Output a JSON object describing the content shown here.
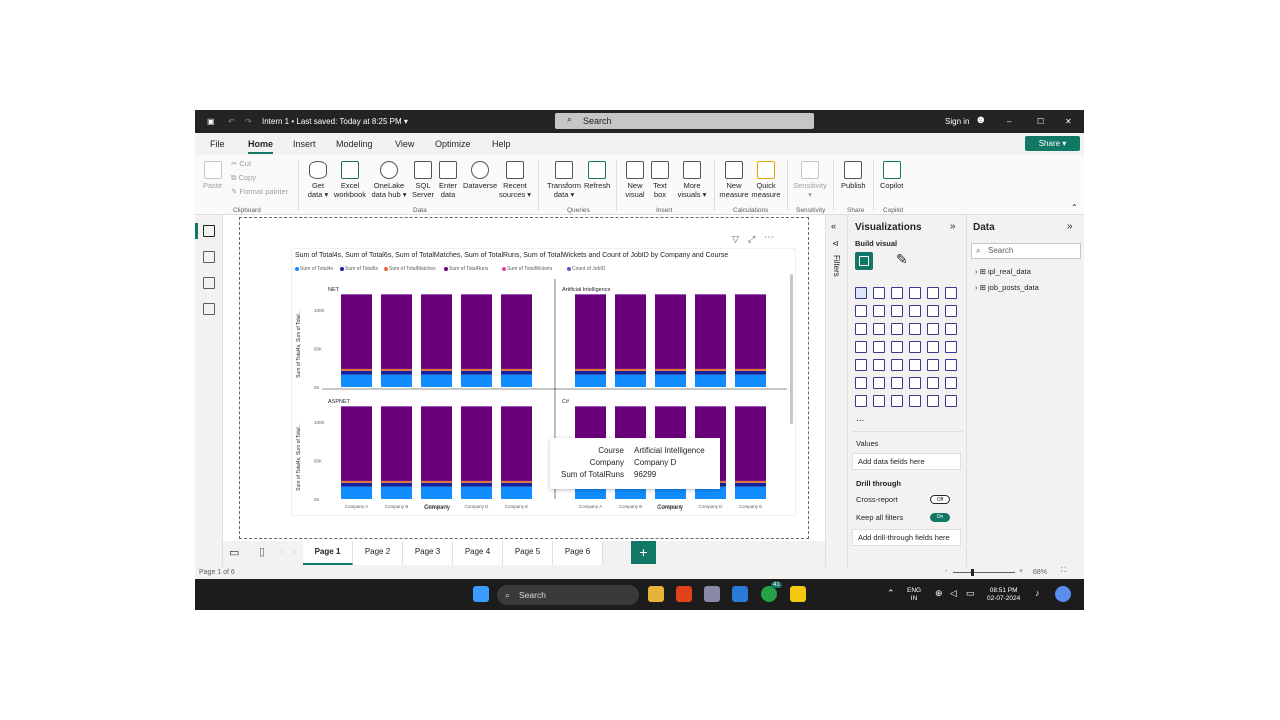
{
  "titlebar": {
    "doc_title": "Intern 1 • Last saved: Today at 8:25 PM ▾",
    "search": "Search",
    "signin": "Sign in",
    "minimize": "–",
    "maximize": "☐",
    "close": "✕"
  },
  "menu": {
    "file": "File",
    "home": "Home",
    "insert": "Insert",
    "modeling": "Modeling",
    "view": "View",
    "optimize": "Optimize",
    "help": "Help",
    "share": "Share ▾"
  },
  "ribbon": {
    "paste": "Paste",
    "cut": "Cut",
    "copy": "Copy",
    "format_painter": "Format painter",
    "get_data": "Get data ▾",
    "excel": "Excel workbook",
    "onelake": "OneLake data hub ▾",
    "sql": "SQL Server",
    "enter_data": "Enter data",
    "dataverse": "Dataverse",
    "recent": "Recent sources ▾",
    "transform": "Transform data ▾",
    "refresh": "Refresh",
    "new_visual": "New visual",
    "text_box": "Text box",
    "more_visuals": "More visuals ▾",
    "new_measure": "New measure",
    "quick_measure": "Quick measure",
    "sensitivity": "Sensitivity ▾",
    "publish": "Publish",
    "copilot": "Copilot",
    "groups": {
      "clipboard": "Clipboard",
      "data": "Data",
      "queries": "Queries",
      "insert": "Insert",
      "calculations": "Calculations",
      "sensitivity": "Sensitivity",
      "share": "Share",
      "copilot": "Copilot"
    }
  },
  "visual": {
    "title": "Sum of Total4s, Sum of Total6s, Sum of TotalMatches, Sum of TotalRuns, Sum of TotalWickets and Count of JobID by Company and Course",
    "legend": [
      "Sum of Total4s",
      "Sum of Total6s",
      "Sum of TotalMatches",
      "Sum of TotalRuns",
      "Sum of TotalWickets",
      "Count of JobID"
    ],
    "ylabel": "Sum of Total4s, Sum of Total...",
    "xlabel": "Company",
    "yticks": [
      "100K",
      "50K",
      "0K"
    ]
  },
  "chart_data": {
    "type": "bar",
    "stacked": true,
    "small_multiples": [
      "NET",
      "Artificial Intelligence",
      "ASPNET",
      "C#"
    ],
    "categories": [
      "Company A",
      "Company B",
      "Company C",
      "Company D",
      "Company E"
    ],
    "series": [
      {
        "name": "Sum of Total4s",
        "color": "#118dff",
        "values": [
          16000,
          16000,
          16000,
          16000,
          16000
        ]
      },
      {
        "name": "Sum of Total6s",
        "color": "#12239e",
        "values": [
          5000,
          5000,
          5000,
          5000,
          5000
        ]
      },
      {
        "name": "Sum of TotalMatches",
        "color": "#e66c37",
        "values": [
          2500,
          2500,
          2500,
          2500,
          2500
        ]
      },
      {
        "name": "Sum of TotalRuns",
        "color": "#6b007b",
        "values": [
          96299,
          96299,
          96299,
          96299,
          96299
        ]
      },
      {
        "name": "Sum of TotalWickets",
        "color": "#e044a7",
        "values": [
          1000,
          1000,
          1000,
          1000,
          1000
        ]
      },
      {
        "name": "Count of JobID",
        "color": "#744ec2",
        "values": [
          1,
          1,
          1,
          1,
          1
        ]
      }
    ],
    "ylim": [
      0,
      130000
    ],
    "ylabel": "Sum of Total4s, Sum of Total...",
    "xlabel": "Company"
  },
  "tooltip": {
    "k1": "Course",
    "v1": "Artificial Intelligence",
    "k2": "Company",
    "v2": "Company D",
    "k3": "Sum of TotalRuns",
    "v3": "96299"
  },
  "pages": [
    "Page 1",
    "Page 2",
    "Page 3",
    "Page 4",
    "Page 5",
    "Page 6"
  ],
  "add_page": "+",
  "filters": {
    "label": "Filters"
  },
  "viz": {
    "title": "Visualizations",
    "build": "Build visual",
    "values": "Values",
    "add_data": "Add data fields here",
    "drill": "Drill through",
    "cross": "Cross-report",
    "cross_state": "Off",
    "keep": "Keep all filters",
    "keep_state": "On",
    "add_drill": "Add drill-through fields here",
    "more": "..."
  },
  "data": {
    "title": "Data",
    "search": "Search",
    "tables": [
      "ipl_real_data",
      "job_posts_data"
    ]
  },
  "status": {
    "page": "Page 1 of 6",
    "zoom": "68%"
  },
  "taskbar": {
    "search": "Search",
    "lang1": "ENG",
    "lang2": "IN",
    "time": "08:51 PM",
    "date": "02-07-2024",
    "badge": "41"
  },
  "colors": {
    "accent": "#117865",
    "titlebar": "#252423"
  }
}
